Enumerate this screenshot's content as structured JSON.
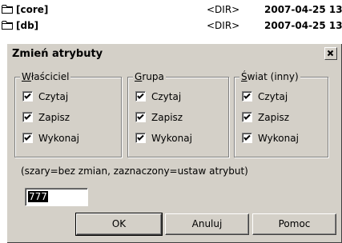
{
  "file_list": {
    "rows": [
      {
        "name": "[core]",
        "type": "<DIR>",
        "date": "2007-04-25 13"
      },
      {
        "name": "[db]",
        "type": "<DIR>",
        "date": "2007-04-25 13"
      }
    ]
  },
  "dialog": {
    "title": "Zmień atrybuty",
    "close_label": "×",
    "groups": [
      {
        "legend_accel": "W",
        "legend_rest": "łaściciel",
        "items": [
          {
            "label": "Czytaj",
            "checked": true
          },
          {
            "label": "Zapisz",
            "checked": true
          },
          {
            "label": "Wykonaj",
            "checked": true
          }
        ]
      },
      {
        "legend_accel": "G",
        "legend_rest": "rupa",
        "items": [
          {
            "label": "Czytaj",
            "checked": true
          },
          {
            "label": "Zapisz",
            "checked": true
          },
          {
            "label": "Wykonaj",
            "checked": true
          }
        ]
      },
      {
        "legend_accel": "Ś",
        "legend_rest": "wiat (inny)",
        "items": [
          {
            "label": "Czytaj",
            "checked": true
          },
          {
            "label": "Zapisz",
            "checked": true
          },
          {
            "label": "Wykonaj",
            "checked": true
          }
        ]
      }
    ],
    "hint": "(szary=bez zmian, zaznaczony=ustaw atrybut)",
    "mode_value": "777",
    "buttons": {
      "ok": "OK",
      "cancel": "Anuluj",
      "help": "Pomoc"
    }
  }
}
